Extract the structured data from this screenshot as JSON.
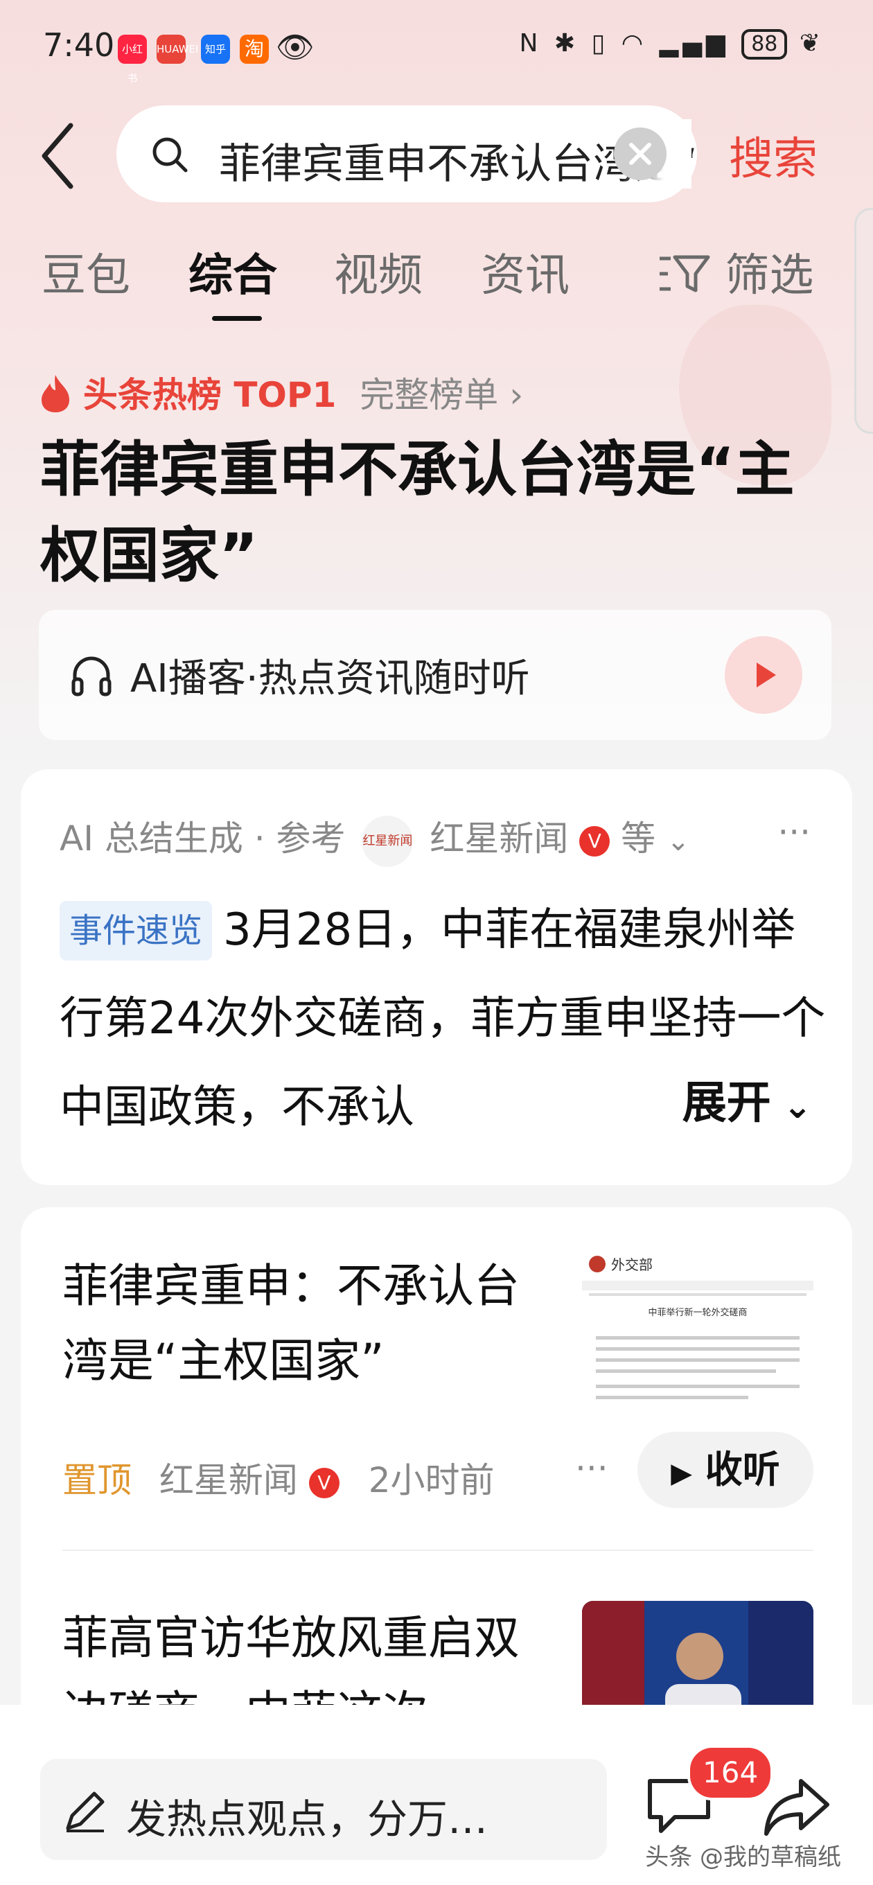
{
  "status_bar": {
    "time": "7:40",
    "apps": [
      {
        "name": "小红书",
        "color": "#ff2442"
      },
      {
        "name": "HUAWEI",
        "color": "#e8443a"
      },
      {
        "name": "知乎",
        "color": "#1772f6"
      },
      {
        "name": "淘",
        "color": "#ff6a00"
      }
    ],
    "battery": "88"
  },
  "search": {
    "query": "菲律宾重申不承认台湾是“主权国家”",
    "button_label": "搜索"
  },
  "tabs": [
    {
      "label": "豆包"
    },
    {
      "label": "综合"
    },
    {
      "label": "视频"
    },
    {
      "label": "资讯"
    }
  ],
  "filter_label": "筛选",
  "hot": {
    "tag": "头条热榜 TOP1",
    "more": "完整榜单"
  },
  "headline": "菲律宾重申不承认台湾是“主权国家”",
  "podcast": {
    "label": "AI播客·热点资讯随时听"
  },
  "ai_summary": {
    "prefix": "AI 总结生成 · 参考",
    "logo_text": "红星新闻",
    "source": "红星新闻",
    "suffix": "等",
    "tag": "事件速览",
    "text": "3月28日，中菲在福建泉州举行第24次外交磋商，菲方重申坚持一个中国政策，不承认",
    "expand": "展开"
  },
  "news": [
    {
      "title": "菲律宾重申：不承认台湾是“主权国家”",
      "pin": "置顶",
      "source": "红星新闻",
      "time": "2小时前",
      "listen": "收听",
      "thumb_heading": "中菲举行新一轮外交磋商"
    },
    {
      "title": "菲高官访华放风重启双边磋商，中菲这次"
    }
  ],
  "bottom": {
    "comment_placeholder": "发热点观点，分万…",
    "comment_count": "164"
  },
  "watermark": "头条 @我的草稿纸",
  "colors": {
    "accent": "#e8443a",
    "pin": "#e0962e",
    "tag_blue": "#3a73c4"
  }
}
